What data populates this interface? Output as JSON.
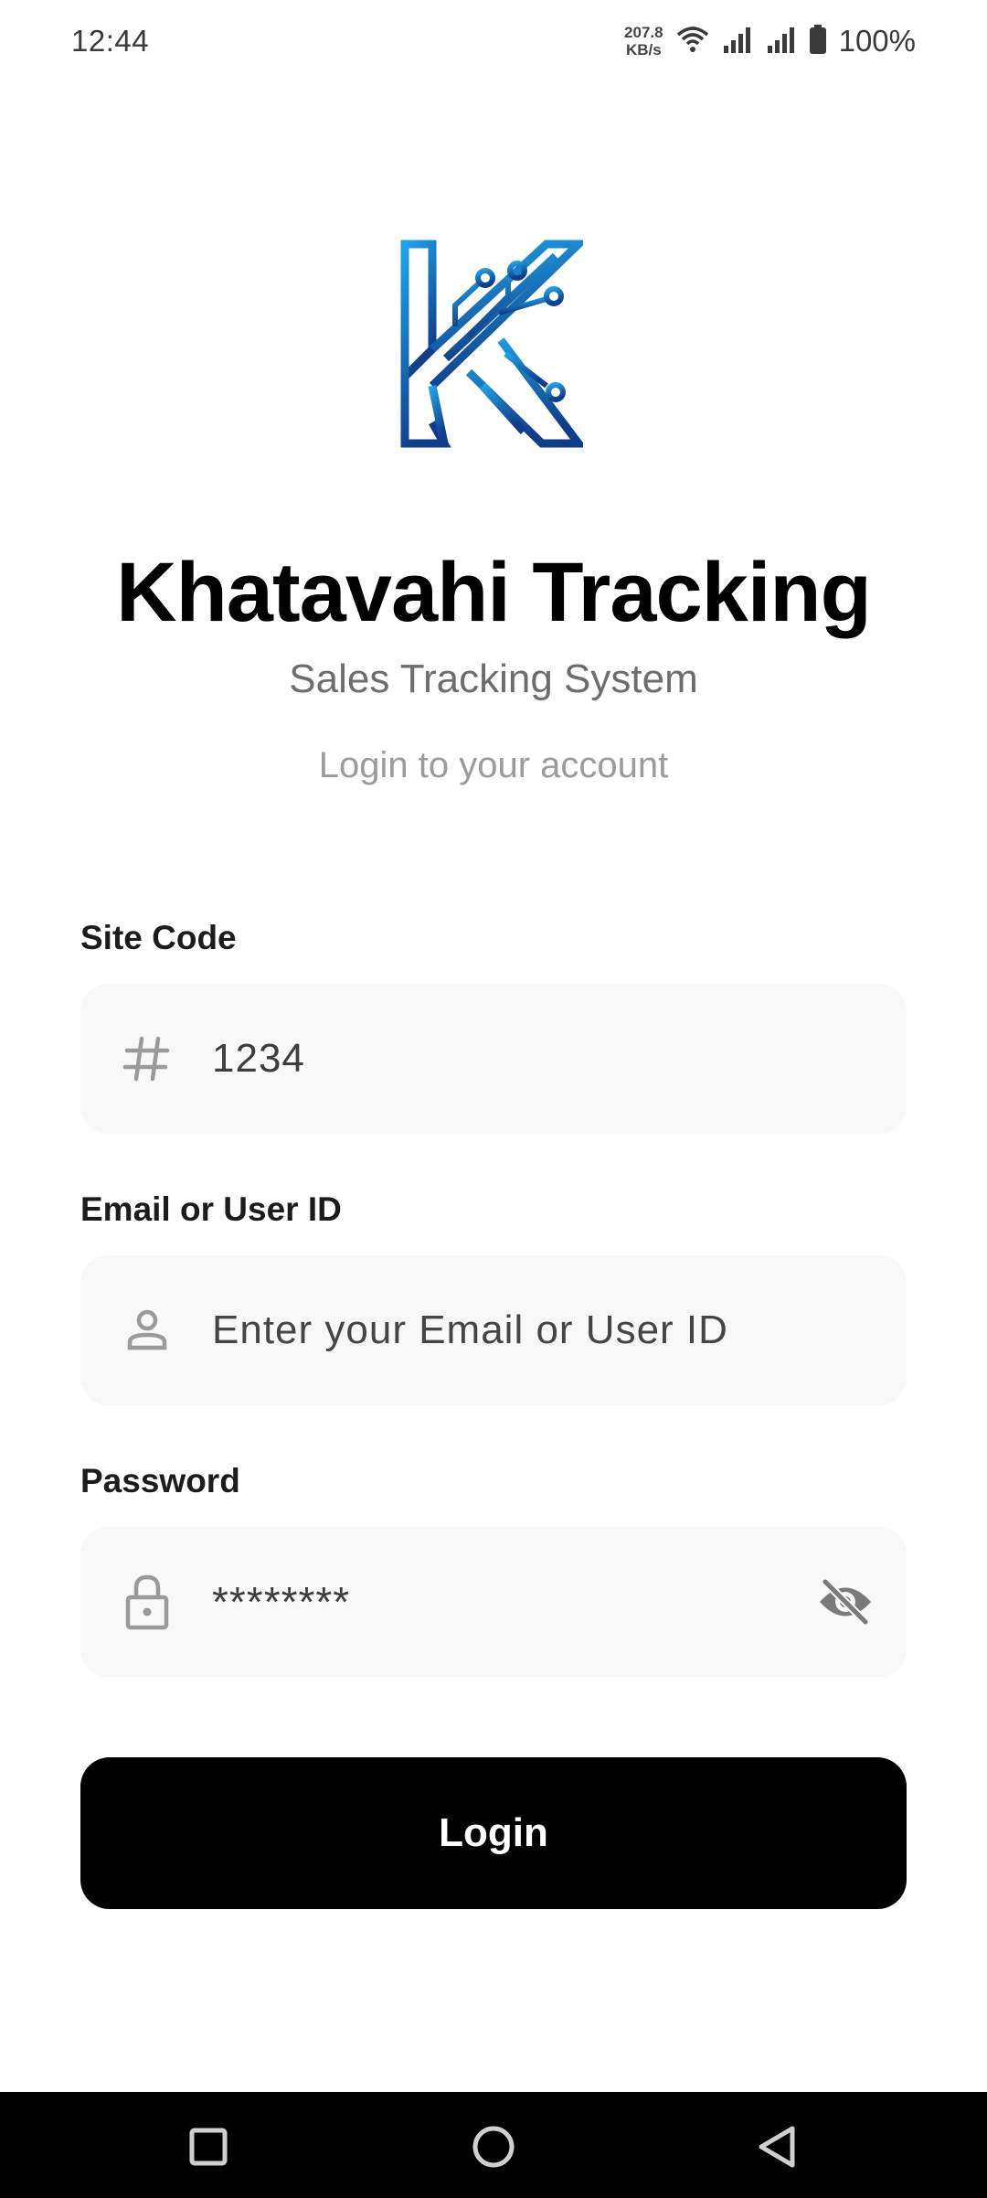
{
  "status_bar": {
    "time": "12:44",
    "net_speed_value": "207.8",
    "net_speed_unit": "KB/s",
    "battery": "100%",
    "icons": [
      "wifi-icon",
      "signal-icon",
      "signal-icon",
      "battery-icon"
    ]
  },
  "header": {
    "title": "Khatavahi Tracking",
    "subtitle": "Sales Tracking System",
    "hint": "Login to your account"
  },
  "form": {
    "site_code": {
      "label": "Site Code",
      "value": "1234",
      "icon": "hash-icon"
    },
    "email": {
      "label": "Email or User ID",
      "placeholder": "Enter your Email or User ID",
      "icon": "person-icon"
    },
    "password": {
      "label": "Password",
      "value": "********",
      "icon": "lock-icon",
      "toggle_icon": "eye-off-icon"
    },
    "submit_label": "Login"
  },
  "colors": {
    "logo_top": "#1fa3e8",
    "logo_bottom": "#0f3d8a",
    "button_bg": "#000000",
    "field_bg": "#f8f8f8"
  },
  "nav_bar": {
    "icons": [
      "recent-apps-icon",
      "home-icon",
      "back-icon"
    ]
  }
}
